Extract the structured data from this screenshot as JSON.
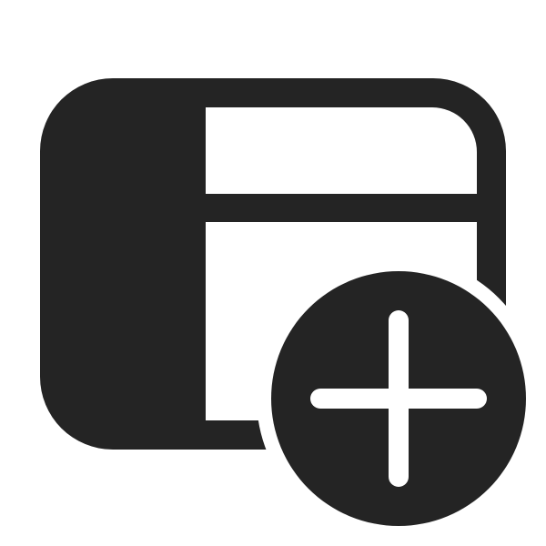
{
  "icon": {
    "name": "window-sidebar-add-icon",
    "parts": [
      "window-frame",
      "sidebar-panel",
      "header-bar",
      "add-badge",
      "plus-sign"
    ]
  },
  "colors": {
    "background": "#ffffff",
    "foreground": "#242424",
    "knockout": "#ffffff"
  }
}
